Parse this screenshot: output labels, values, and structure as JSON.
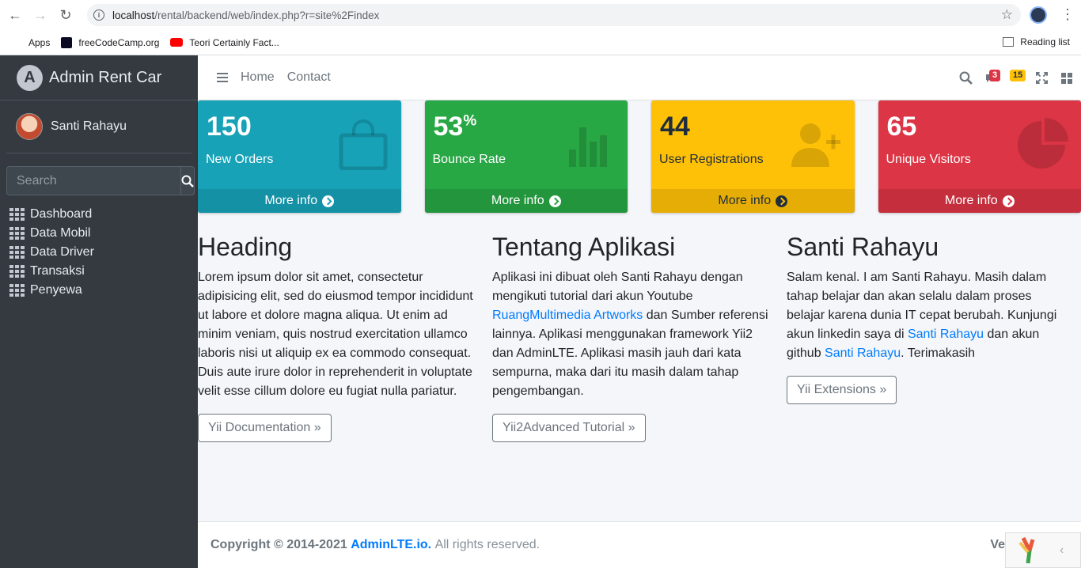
{
  "browser": {
    "url_host": "localhost",
    "url_path": "/rental/backend/web/index.php?r=site%2Findex",
    "bookmarks": [
      "Apps",
      "freeCodeCamp.org",
      "Teori Certainly Fact..."
    ],
    "reading_list": "Reading list"
  },
  "sidebar": {
    "brand": "Admin Rent Car",
    "user": "Santi Rahayu",
    "search_placeholder": "Search",
    "items": [
      {
        "label": "Dashboard"
      },
      {
        "label": "Data Mobil"
      },
      {
        "label": "Data Driver"
      },
      {
        "label": "Transaksi"
      },
      {
        "label": "Penyewa"
      }
    ]
  },
  "navbar": {
    "links": [
      "Home",
      "Contact"
    ],
    "notif_badge": "3",
    "alerts_badge": "15"
  },
  "boxes": [
    {
      "value": "150",
      "suffix": "",
      "label": "New Orders",
      "more": "More info",
      "color": "#17a2b8",
      "icon": "shopping-bag-icon"
    },
    {
      "value": "53",
      "suffix": "%",
      "label": "Bounce Rate",
      "more": "More info",
      "color": "#28a745",
      "icon": "bar-chart-icon"
    },
    {
      "value": "44",
      "suffix": "",
      "label": "User Registrations",
      "more": "More info",
      "color": "#ffc107",
      "icon": "user-plus-icon"
    },
    {
      "value": "65",
      "suffix": "",
      "label": "Unique Visitors",
      "more": "More info",
      "color": "#dc3545",
      "icon": "pie-chart-icon"
    }
  ],
  "columns": [
    {
      "heading": "Heading",
      "text": "Lorem ipsum dolor sit amet, consectetur adipisicing elit, sed do eiusmod tempor incididunt ut labore et dolore magna aliqua. Ut enim ad minim veniam, quis nostrud exercitation ullamco laboris nisi ut aliquip ex ea commodo consequat. Duis aute irure dolor in reprehenderit in voluptate velit esse cillum dolore eu fugiat nulla pariatur.",
      "button": "Yii Documentation »"
    },
    {
      "heading": "Tentang Aplikasi",
      "text_a": "Aplikasi ini dibuat oleh Santi Rahayu dengan mengikuti tutorial dari akun Youtube ",
      "link": "RuangMultimedia Artworks",
      "text_b": " dan Sumber referensi lainnya. Aplikasi menggunakan framework Yii2 dan AdminLTE. Aplikasi masih jauh dari kata sempurna, maka dari itu masih dalam tahap pengembangan.",
      "button": "Yii2Advanced Tutorial »"
    },
    {
      "heading": "Santi Rahayu",
      "text_a": "Salam kenal. I am Santi Rahayu. Masih dalam tahap belajar dan akan selalu dalam proses belajar karena dunia IT cepat berubah. Kunjungi akun linkedin saya di ",
      "link1": "Santi Rahayu",
      "text_b": " dan akun github ",
      "link2": "Santi Rahayu",
      "text_c": ". Terimakasih",
      "button": "Yii Extensions »"
    }
  ],
  "footer": {
    "copyright": "Copyright © 2014-2021",
    "brand": "AdminLTE.io.",
    "rights": "All rights reserved.",
    "version": "Ve"
  }
}
